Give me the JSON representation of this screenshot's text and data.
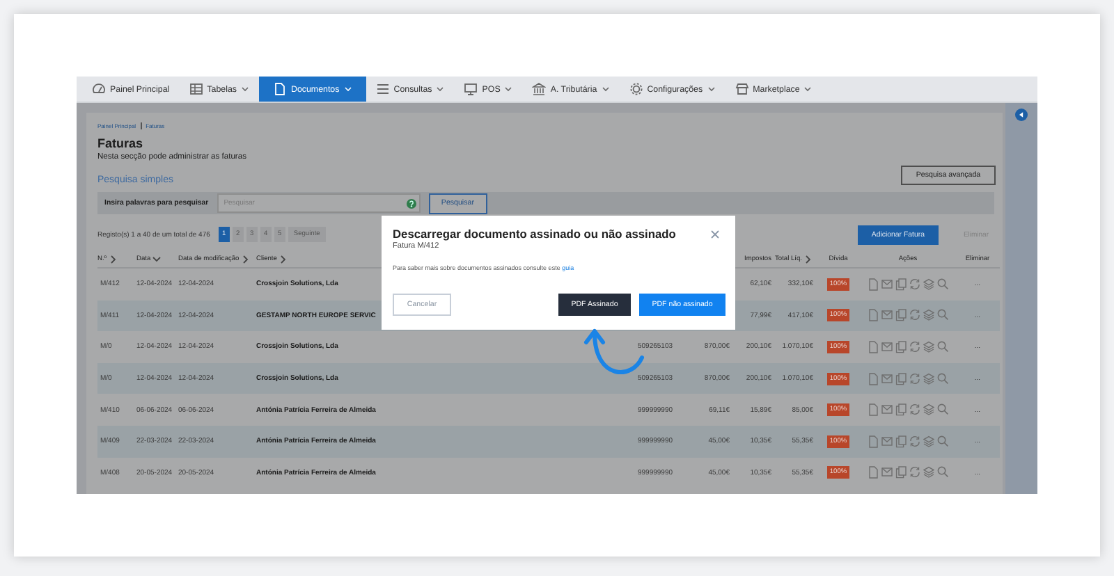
{
  "nav": {
    "items": [
      {
        "label": "Painel Principal",
        "selected": false,
        "dropdown": false
      },
      {
        "label": "Tabelas",
        "selected": false,
        "dropdown": true
      },
      {
        "label": "Documentos",
        "selected": true,
        "dropdown": true
      },
      {
        "label": "Consultas",
        "selected": false,
        "dropdown": true
      },
      {
        "label": "POS",
        "selected": false,
        "dropdown": true
      },
      {
        "label": "A. Tributária",
        "selected": false,
        "dropdown": true
      },
      {
        "label": "Configurações",
        "selected": false,
        "dropdown": true
      },
      {
        "label": "Marketplace",
        "selected": false,
        "dropdown": true
      }
    ]
  },
  "breadcrumb": [
    "Painel Principal",
    "Faturas"
  ],
  "page": {
    "title": "Faturas",
    "subtitle": "Nesta secção pode administrar as faturas"
  },
  "search": {
    "section_title": "Pesquisa simples",
    "advanced_button": "Pesquisa avançada",
    "label": "Insira palavras para pesquisar",
    "placeholder": "Pesquisar",
    "button": "Pesquisar"
  },
  "records": "Registo(s) 1 a 40 de um total de 476",
  "pagination": {
    "pages": [
      {
        "label": "1",
        "selected": true
      },
      {
        "label": "2",
        "selected": false
      },
      {
        "label": "3",
        "selected": false
      },
      {
        "label": "4",
        "selected": false
      },
      {
        "label": "5",
        "selected": false
      }
    ],
    "next": "Seguinte"
  },
  "add_button": "Adicionar Fatura",
  "delete_button": {
    "label": "Eliminar",
    "disabled": true
  },
  "table": {
    "columns": [
      {
        "label": "N.º",
        "sortable": true,
        "descending": false
      },
      {
        "label": "Data",
        "sortable": true,
        "descending": true
      },
      {
        "label": "Data de modificação",
        "sortable": true,
        "descending": false
      },
      {
        "label": "Cliente",
        "sortable": true,
        "descending": false
      },
      {},
      {},
      {
        "label": "Impostos"
      },
      {
        "label": "Total Líq.",
        "sortable": true,
        "descending": false
      },
      {
        "label": "Dívida"
      },
      {
        "label": "Ações"
      },
      {
        "label": "Eliminar"
      }
    ],
    "rows": [
      {
        "cells": [
          "M/412",
          "12-04-2024",
          "12-04-2024",
          "Crossjoin Solutions, Lda",
          null,
          null,
          "62,10€",
          "332,10€"
        ],
        "debt": "100%",
        "delete": "..."
      },
      {
        "cells": [
          "M/411",
          "12-04-2024",
          "12-04-2024",
          "GESTAMP NORTH EUROPE SERVIC",
          null,
          null,
          "77,99€",
          "417,10€"
        ],
        "debt": "100%",
        "delete": "..."
      },
      {
        "cells": [
          "M/0",
          "12-04-2024",
          "12-04-2024",
          "Crossjoin Solutions, Lda",
          "509265103",
          "870,00€",
          "200,10€",
          "1.070,10€"
        ],
        "debt": "100%",
        "delete": "..."
      },
      {
        "cells": [
          "M/0",
          "12-04-2024",
          "12-04-2024",
          "Crossjoin Solutions, Lda",
          "509265103",
          "870,00€",
          "200,10€",
          "1.070,10€"
        ],
        "debt": "100%",
        "delete": "..."
      },
      {
        "cells": [
          "M/410",
          "06-06-2024",
          "06-06-2024",
          "Antónia Patrícia Ferreira de Almeida",
          "999999990",
          "69,11€",
          "15,89€",
          "85,00€"
        ],
        "debt": "100%",
        "delete": "..."
      },
      {
        "cells": [
          "M/409",
          "22-03-2024",
          "22-03-2024",
          "Antónia Patrícia Ferreira de Almeida",
          "999999990",
          "45,00€",
          "10,35€",
          "55,35€"
        ],
        "debt": "100%",
        "delete": "..."
      },
      {
        "cells": [
          "M/408",
          "20-05-2024",
          "20-05-2024",
          "Antónia Patrícia Ferreira de Almeida",
          "999999990",
          "45,00€",
          "10,35€",
          "55,35€"
        ],
        "debt": "100%",
        "delete": "..."
      }
    ]
  },
  "dialog": {
    "title": "Descarregar documento assinado ou não assinado",
    "subtitle": "Fatura M/412",
    "text": "Para saber mais sobre documentos assinados consulte este ",
    "link": "guia",
    "buttons": [
      {
        "label": "Cancelar",
        "kind": "outline"
      },
      {
        "label": "PDF Assinado",
        "kind": "dark"
      },
      {
        "label": "PDF não assinado",
        "kind": "primary"
      }
    ]
  }
}
